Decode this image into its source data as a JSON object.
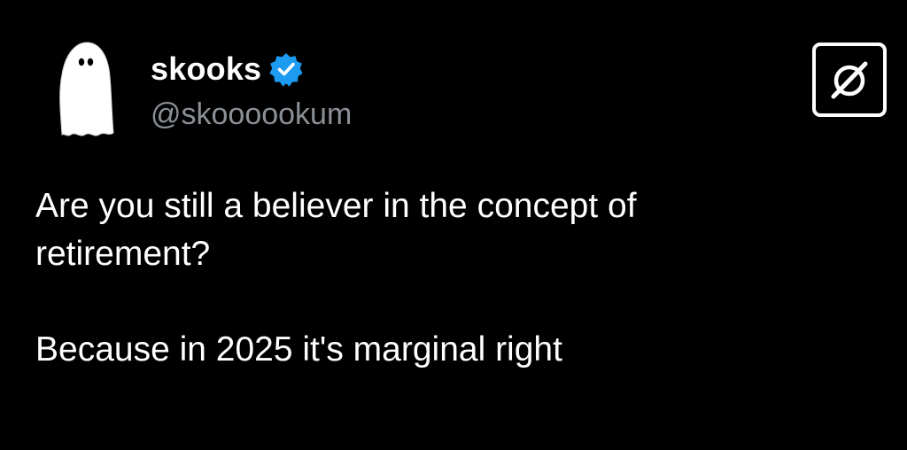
{
  "author": {
    "display_name": "skooks",
    "handle": "@skoooookum",
    "verified": true,
    "avatar_icon": "ghost-icon",
    "verified_icon": "verified-badge-icon"
  },
  "brand": {
    "logo_icon": "slashed-circle-logo-icon"
  },
  "tweet": {
    "line1": "Are you still a believer in the concept of",
    "line2": "retirement?",
    "line3": "Because in 2025 it's marginal right"
  },
  "colors": {
    "background": "#000000",
    "text": "#ffffff",
    "handle": "#8b9096",
    "verified": "#1d9bf0"
  }
}
